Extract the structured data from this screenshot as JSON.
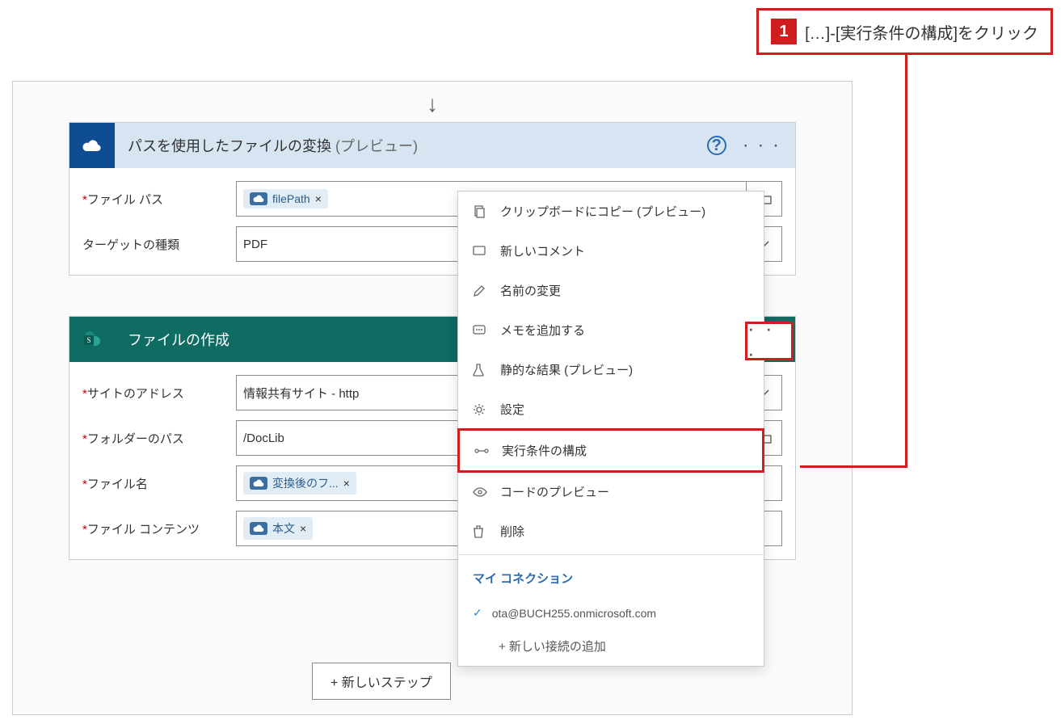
{
  "callout": {
    "number": "1",
    "text": "[…]-[実行条件の構成]をクリック"
  },
  "card1": {
    "title": "パスを使用したファイルの変換",
    "title_suffix": "(プレビュー)",
    "fields": {
      "file_path_label": "ファイル パス",
      "file_path_token": "filePath",
      "target_type_label": "ターゲットの種類",
      "target_type_value": "PDF"
    }
  },
  "card2": {
    "title": "ファイルの作成",
    "fields": {
      "site_address_label": "サイトのアドレス",
      "site_address_value": "情報共有サイト - http",
      "folder_path_label": "フォルダーのパス",
      "folder_path_value": "/DocLib",
      "file_name_label": "ファイル名",
      "file_name_token": "変換後のフ...",
      "file_content_label": "ファイル コンテンツ",
      "file_content_token": "本文"
    }
  },
  "dropdown": {
    "copy": "クリップボードにコピー (プレビュー)",
    "comment": "新しいコメント",
    "rename": "名前の変更",
    "note": "メモを追加する",
    "static_result": "静的な結果 (プレビュー)",
    "settings": "設定",
    "run_after": "実行条件の構成",
    "peek_code": "コードのプレビュー",
    "delete": "削除",
    "my_connection": "マイ コネクション",
    "connection_email": "ota@BUCH255.onmicrosoft.com",
    "add_connection": "+ 新しい接続の追加"
  },
  "new_step": "+ 新しいステップ",
  "icons": {
    "more": "· · ·",
    "help": "?",
    "close_x": "×",
    "check": "✓"
  }
}
